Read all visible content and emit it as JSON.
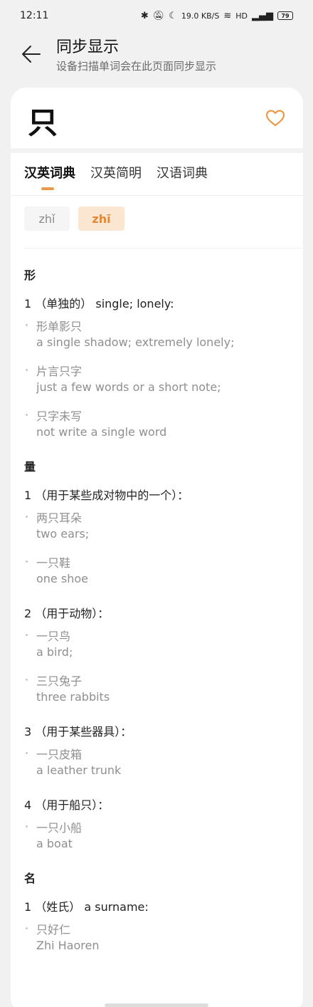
{
  "status": {
    "time": "12:11",
    "speed": "19.0 KB/S",
    "network": "HD",
    "battery": "79"
  },
  "header": {
    "title": "同步显示",
    "subtitle": "设备扫描单词会在此页面同步显示"
  },
  "entry": {
    "word": "只",
    "favorite_icon": "heart-outline-icon"
  },
  "tabs": [
    "汉英词典",
    "汉英简明",
    "汉语词典"
  ],
  "active_tab": 0,
  "pinyin": [
    "zhǐ",
    "zhī"
  ],
  "selected_pinyin": 1,
  "sections": [
    {
      "pos": "形",
      "senses": [
        {
          "label": "1 （单独的） single; lonely:",
          "examples": [
            {
              "cn": "形单影只",
              "en": "a single shadow; extremely lonely;"
            },
            {
              "cn": "片言只字",
              "en": "just a few words or a short note;"
            },
            {
              "cn": "只字未写",
              "en": "not write a single word"
            }
          ]
        }
      ]
    },
    {
      "pos": "量",
      "senses": [
        {
          "label": "1 （用于某些成对物中的一个）：",
          "examples": [
            {
              "cn": "两只耳朵",
              "en": "two ears;"
            },
            {
              "cn": "一只鞋",
              "en": "one shoe"
            }
          ]
        },
        {
          "label": "2 （用于动物）：",
          "examples": [
            {
              "cn": "一只鸟",
              "en": "a bird;"
            },
            {
              "cn": "三只兔子",
              "en": "three rabbits"
            }
          ]
        },
        {
          "label": "3 （用于某些器具）：",
          "examples": [
            {
              "cn": "一只皮箱",
              "en": "a leather trunk"
            }
          ]
        },
        {
          "label": "4 （用于船只）：",
          "examples": [
            {
              "cn": "一只小船",
              "en": "a boat"
            }
          ]
        }
      ]
    },
    {
      "pos": "名",
      "senses": [
        {
          "label": "1 （姓氏） a surname:",
          "examples": [
            {
              "cn": "只好仁",
              "en": "Zhi Haoren"
            }
          ]
        }
      ]
    }
  ],
  "colors": {
    "accent": "#e99b4a",
    "accent_bg": "#fbe6d2",
    "page_bg": "#f1f1f1"
  }
}
